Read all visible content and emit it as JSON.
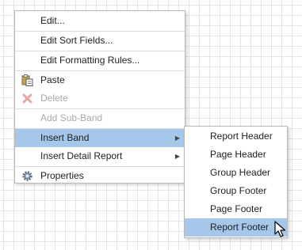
{
  "context_menu": {
    "items": [
      {
        "label": "Edit...",
        "enabled": true
      },
      {
        "label": "Edit Sort Fields...",
        "enabled": true
      },
      {
        "label": "Edit Formatting Rules...",
        "enabled": true
      },
      {
        "label": "Paste",
        "enabled": true,
        "icon": "paste-icon"
      },
      {
        "label": "Delete",
        "enabled": false,
        "icon": "delete-icon"
      },
      {
        "label": "Add Sub-Band",
        "enabled": false
      },
      {
        "label": "Insert Band",
        "enabled": true,
        "submenu": true,
        "highlighted": true
      },
      {
        "label": "Insert Detail Report",
        "enabled": true,
        "submenu": true
      },
      {
        "label": "Properties",
        "enabled": true,
        "icon": "gear-icon"
      }
    ]
  },
  "insert_band_submenu": {
    "items": [
      {
        "label": "Report Header"
      },
      {
        "label": "Page Header"
      },
      {
        "label": "Group Header"
      },
      {
        "label": "Group Footer"
      },
      {
        "label": "Page Footer"
      },
      {
        "label": "Report Footer",
        "highlighted": true
      }
    ]
  },
  "colors": {
    "highlight": "#a5c8ea",
    "grid_line": "#e6e6e6",
    "disabled_text": "#a8a8a8"
  }
}
